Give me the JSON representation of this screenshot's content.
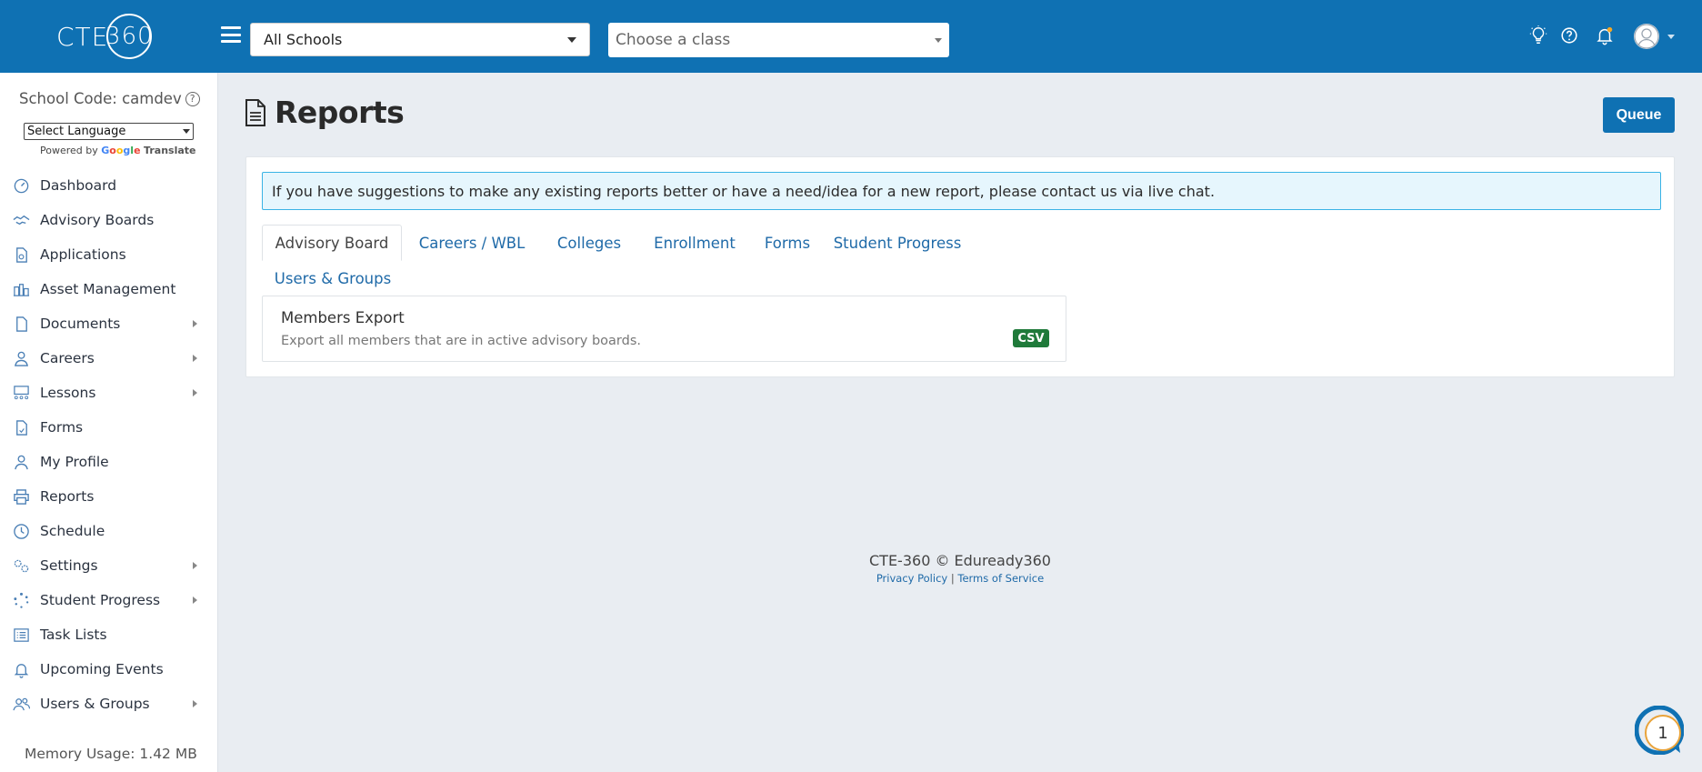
{
  "header": {
    "logo_text": "CTE",
    "logo_circle_text": "360",
    "school_select": {
      "value": "All Schools"
    },
    "class_select": {
      "placeholder": "Choose a class"
    },
    "icons": [
      "lightbulb-icon",
      "help-icon",
      "bell-icon",
      "user-avatar-icon"
    ],
    "colors": {
      "brand": "#0f71b3",
      "notification_dot": "#f5a623"
    }
  },
  "sidebar": {
    "school_code": "School Code: camdev",
    "language_select": {
      "value": "Select Language"
    },
    "powered_by": "Powered by",
    "google": "Google",
    "translate": "Translate",
    "items": [
      {
        "label": "Dashboard",
        "icon": "dashboard-icon",
        "has_submenu": false
      },
      {
        "label": "Advisory Boards",
        "icon": "handshake-icon",
        "has_submenu": false
      },
      {
        "label": "Applications",
        "icon": "application-icon",
        "has_submenu": false
      },
      {
        "label": "Asset Management",
        "icon": "asset-icon",
        "has_submenu": false
      },
      {
        "label": "Documents",
        "icon": "document-icon",
        "has_submenu": true
      },
      {
        "label": "Careers",
        "icon": "career-icon",
        "has_submenu": true
      },
      {
        "label": "Lessons",
        "icon": "lessons-icon",
        "has_submenu": true
      },
      {
        "label": "Forms",
        "icon": "forms-icon",
        "has_submenu": false
      },
      {
        "label": "My Profile",
        "icon": "profile-icon",
        "has_submenu": false
      },
      {
        "label": "Reports",
        "icon": "printer-icon",
        "has_submenu": false
      },
      {
        "label": "Schedule",
        "icon": "clock-icon",
        "has_submenu": false
      },
      {
        "label": "Settings",
        "icon": "gear-icon",
        "has_submenu": true
      },
      {
        "label": "Student Progress",
        "icon": "progress-icon",
        "has_submenu": true
      },
      {
        "label": "Task Lists",
        "icon": "task-list-icon",
        "has_submenu": false
      },
      {
        "label": "Upcoming Events",
        "icon": "bell-icon",
        "has_submenu": false
      },
      {
        "label": "Users & Groups",
        "icon": "users-icon",
        "has_submenu": true
      }
    ],
    "memory_usage": "Memory Usage: 1.42 MB"
  },
  "main": {
    "title": "Reports",
    "queue_button": "Queue",
    "alert": "If you have suggestions to make any existing reports better or have a need/idea for a new report, please contact us via live chat.",
    "tabs": [
      {
        "label": "Advisory Board",
        "active": true
      },
      {
        "label": "Careers / WBL",
        "active": false
      },
      {
        "label": "Colleges",
        "active": false
      },
      {
        "label": "Enrollment",
        "active": false
      },
      {
        "label": "Forms",
        "active": false
      },
      {
        "label": "Student Progress",
        "active": false
      },
      {
        "label": "Users & Groups",
        "active": false
      }
    ],
    "reports": [
      {
        "title": "Members Export",
        "description": "Export all members that are in active advisory boards.",
        "format": "CSV"
      }
    ]
  },
  "footer": {
    "copyright": "CTE-360 © Eduready360",
    "privacy": "Privacy Policy",
    "separator": "|",
    "terms": "Terms of Service"
  },
  "chat_widget": {
    "count": "1"
  }
}
